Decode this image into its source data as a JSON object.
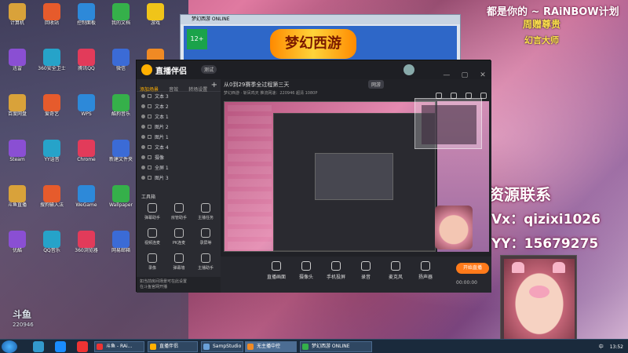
{
  "overlay": {
    "top_banner": "都是你的 ~ RAiNBOW计划",
    "badge_line1": "周赠尊贵",
    "badge_line2": "幻言大师",
    "promo_line1": "接资源联系",
    "promo_line2": "Vx：qizixi1026",
    "promo_line3": "YY：15679275"
  },
  "game_window": {
    "title": "梦幻西游 ONLINE",
    "age_badge": "12+",
    "logo_text": "梦幻西游"
  },
  "app": {
    "name": "直播伴侣",
    "beta_tag": "测试",
    "tabs": [
      "添加场景",
      "音效",
      "转场设置"
    ],
    "sources": [
      "文本 3",
      "文本 2",
      "文本 1",
      "图片 2",
      "图片 1",
      "文本 4",
      "摄像",
      "全屏 1",
      "图片 3"
    ],
    "tools_heading": "工具箱",
    "tools": [
      "弹幕助手",
      "房管助手",
      "主播任务",
      "视频连麦",
      "PK连麦",
      "录屏等",
      "录像",
      "弹幕墙",
      "主播助手"
    ],
    "footer_note": "如当前房间场景可在此设置",
    "footer_link": "在斗鱼官网开播"
  },
  "stage": {
    "title": "从0到29赛季全过程第三天",
    "tag": "网游",
    "sub": "梦幻西游 · 斩凤鸣天  推流网速：220946  超清 1080P",
    "controls": [
      "直播画面",
      "摄像头",
      "手机投屏",
      "录音",
      "麦克风",
      "扬声器"
    ],
    "live_button": "开始直播",
    "timer": "00:00:00"
  },
  "watermark": {
    "brand": "斗鱼",
    "room_number": "220946"
  },
  "taskbar": {
    "tasks": [
      "斗鱼 - RAi...",
      "直播伴侣",
      "SampStudio Pro",
      "无主播中控",
      "梦幻西游 ONLINE"
    ],
    "tray_time": "13:52",
    "tray_lang": "中"
  },
  "desktop_icons": [
    "计算机",
    "回收站",
    "控制面板",
    "我的文档",
    "游戏",
    "迅雷",
    "360安全卫士",
    "腾讯QQ",
    "微信",
    "网易云",
    "百度网盘",
    "爱奇艺",
    "WPS",
    "酷狗音乐",
    "Adobe",
    "Steam",
    "YY语音",
    "Chrome",
    "新建文件夹",
    "截图",
    "斗鱼直播",
    "搜狗输入法",
    "WeGame",
    "Wallpaper",
    "腾讯视频",
    "优酷",
    "QQ音乐",
    "360浏览器",
    "网易邮箱",
    "OBS"
  ],
  "colors": {
    "accent_orange": "#ff7a1a",
    "app_bg": "#24252b",
    "tab_active": "#ffb000",
    "promo_text": "#ffffff",
    "badge_yellow": "#ffe14d"
  }
}
